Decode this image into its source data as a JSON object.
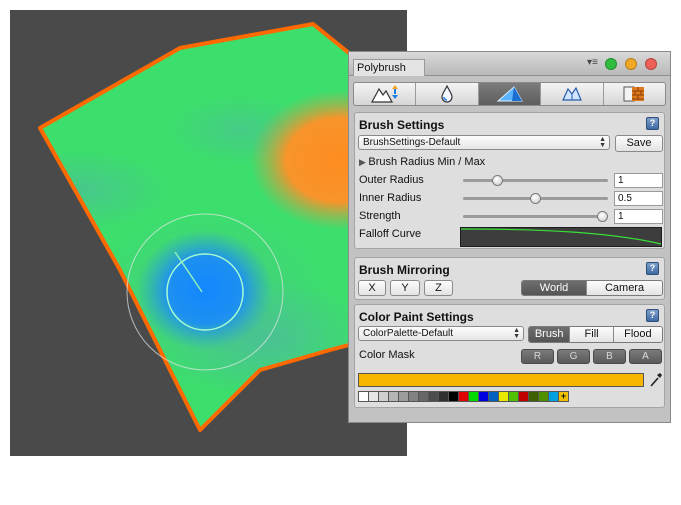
{
  "window": {
    "tab_title": "Polybrush",
    "menu_icon": "▾≡",
    "buttons": [
      {
        "name": "close",
        "color": "#2fbd3f"
      },
      {
        "name": "minimize",
        "color": "#f0a924"
      },
      {
        "name": "zoom",
        "color": "#ee5f57"
      }
    ]
  },
  "tool_tabs": [
    {
      "name": "sculpt-mode-icon",
      "active": false
    },
    {
      "name": "smooth-mode-icon",
      "active": false
    },
    {
      "name": "paint-mode-icon",
      "active": true
    },
    {
      "name": "scatter-mode-icon",
      "active": false
    },
    {
      "name": "texture-mode-icon",
      "active": false
    }
  ],
  "brush_settings": {
    "title": "Brush Settings",
    "preset": "BrushSettings-Default",
    "save_label": "Save",
    "radius_minmax_label": "Brush Radius Min / Max",
    "outer_radius": {
      "label": "Outer Radius",
      "value": "1",
      "level": 0.22
    },
    "inner_radius": {
      "label": "Inner Radius",
      "value": "0.5",
      "level": 0.5
    },
    "strength": {
      "label": "Strength",
      "value": "1",
      "level": 1.0
    },
    "falloff_label": "Falloff Curve",
    "help": "?"
  },
  "brush_mirroring": {
    "title": "Brush Mirroring",
    "axes": [
      "X",
      "Y",
      "Z"
    ],
    "space": [
      "World",
      "Camera"
    ],
    "space_selected": "World",
    "help": "?"
  },
  "color_paint": {
    "title": "Color Paint Settings",
    "palette": "ColorPalette-Default",
    "modes": [
      "Brush",
      "Fill",
      "Flood"
    ],
    "mode_selected": "Brush",
    "color_mask_label": "Color Mask",
    "channels": [
      "R",
      "G",
      "B",
      "A"
    ],
    "current_color": "#f8b500",
    "swatches": [
      "#ffffff",
      "#e6e6e6",
      "#cfcfcf",
      "#b5b5b5",
      "#9c9c9c",
      "#828282",
      "#676767",
      "#4d4d4d",
      "#303030",
      "#000000",
      "#e00000",
      "#00d800",
      "#0000e0",
      "#0060c0",
      "#e8e800",
      "#50c000",
      "#c00000",
      "#406000",
      "#509000",
      "#00a0e0"
    ],
    "help": "?"
  },
  "colors": {
    "accent_orange": "#ff6a00",
    "mesh_green": "#3ddc6a",
    "brush_blue": "#1a8cff"
  }
}
